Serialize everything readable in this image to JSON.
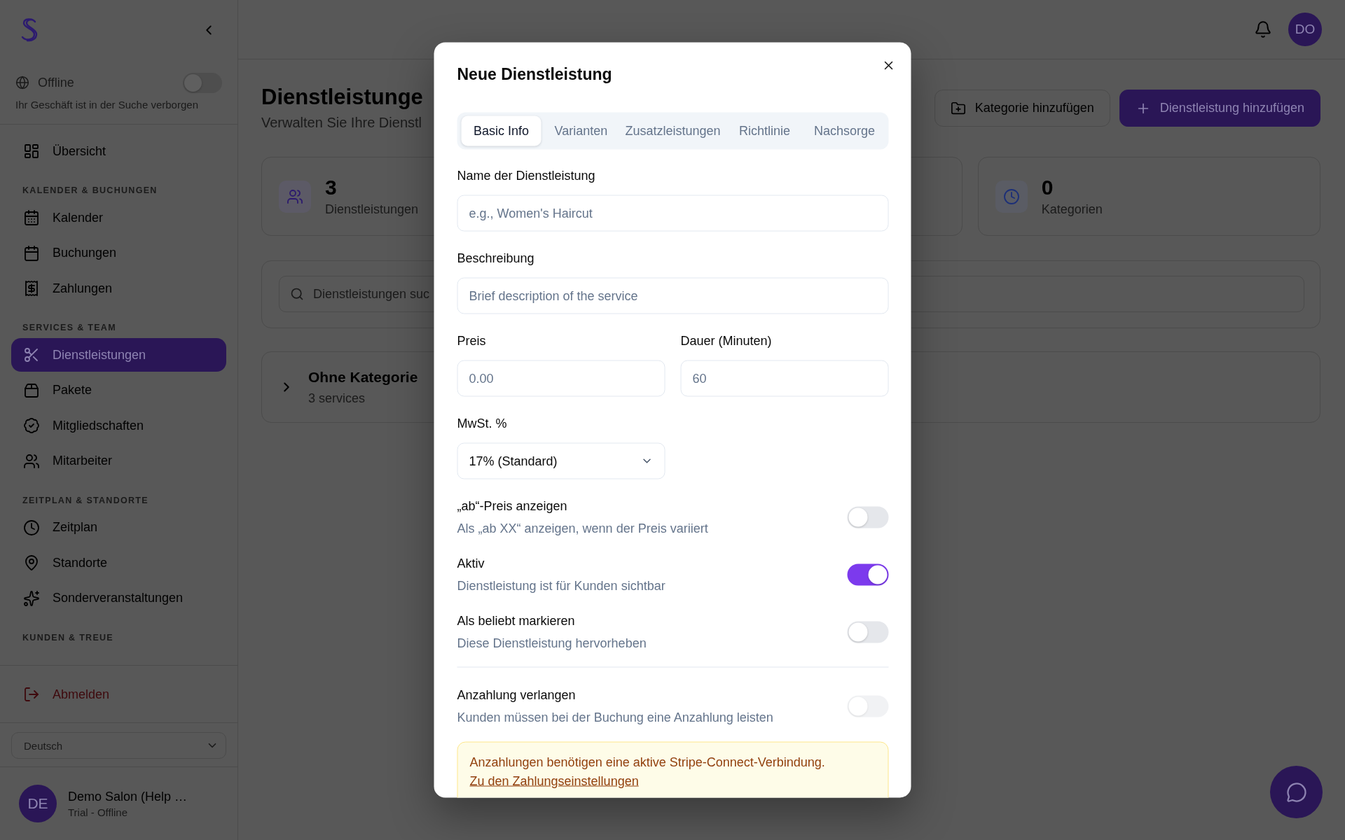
{
  "sidebar": {
    "status": {
      "label": "Offline",
      "description": "Ihr Geschäft ist in der Suche verborgen",
      "on": false
    },
    "nav": [
      {
        "items": [
          {
            "label": "Übersicht",
            "selected": false
          }
        ]
      },
      {
        "heading": "KALENDER & BUCHUNGEN",
        "items": [
          {
            "label": "Kalender",
            "selected": false
          },
          {
            "label": "Buchungen",
            "selected": false
          },
          {
            "label": "Zahlungen",
            "selected": false
          }
        ]
      },
      {
        "heading": "SERVICES & TEAM",
        "items": [
          {
            "label": "Dienstleistungen",
            "selected": true
          },
          {
            "label": "Pakete",
            "selected": false
          },
          {
            "label": "Mitgliedschaften",
            "selected": false
          },
          {
            "label": "Mitarbeiter",
            "selected": false
          }
        ]
      },
      {
        "heading": "ZEITPLAN & STANDORTE",
        "items": [
          {
            "label": "Zeitplan",
            "selected": false
          },
          {
            "label": "Standorte",
            "selected": false
          },
          {
            "label": "Sonderveranstaltungen",
            "selected": false
          }
        ]
      },
      {
        "heading": "KUNDEN & TREUE"
      }
    ],
    "logout": {
      "label": "Abmelden"
    },
    "language": {
      "value": "Deutsch"
    },
    "account": {
      "initials": "DE",
      "name": "Demo Salon (Help …",
      "status": "Trial - Offline"
    }
  },
  "topbar": {
    "avatar": "DO"
  },
  "page": {
    "title": "Dienstleistunge",
    "subtitle": "Verwalten Sie Ihre Dienstl",
    "buttons": [
      {
        "kind": "secondary",
        "label": "Kategorie hinzufügen"
      },
      {
        "kind": "primary",
        "label": "Dienstleistung hinzufügen"
      }
    ],
    "stats": [
      {
        "kind": "stat",
        "value": "3",
        "label": "Dienstleistungen"
      },
      {
        "kind": "covered"
      },
      {
        "kind": "stat",
        "value": "0",
        "label": "Kategorien"
      }
    ],
    "search": {
      "placeholder": "Dienstleistungen suc"
    },
    "categories": [
      {
        "name": "Ohne Kategorie",
        "count": "3 services",
        "expanded": false
      }
    ]
  },
  "dialog": {
    "title": "Neue Dienstleistung",
    "tabs": [
      {
        "label": "Basic Info",
        "selected": true
      },
      {
        "label": "Varianten",
        "selected": false
      },
      {
        "label": "Zusatzleistungen",
        "selected": false
      },
      {
        "label": "Richtlinie",
        "selected": false
      },
      {
        "label": "Nachsorge",
        "selected": false
      }
    ],
    "fields": [
      {
        "label": "Name der Dienstleistung",
        "placeholder": "e.g., Women's Haircut"
      },
      {
        "label": "Beschreibung",
        "placeholder": "Brief description of the service"
      }
    ],
    "pair_fields": [
      {
        "label": "Preis",
        "placeholder": "0.00"
      },
      {
        "label": "Dauer (Minuten)",
        "placeholder": "60"
      }
    ],
    "vat": {
      "label": "MwSt. %",
      "value": "17% (Standard)"
    },
    "toggles": [
      {
        "label": "„ab“-Preis anzeigen",
        "description": "Als „ab XX“ anzeigen, wenn der Preis variiert",
        "on": false,
        "disabled": false
      },
      {
        "label": "Aktiv",
        "description": "Dienstleistung ist für Kunden sichtbar",
        "on": true,
        "disabled": false
      },
      {
        "label": "Als beliebt markieren",
        "description": "Diese Dienstleistung hervorheben",
        "on": false,
        "disabled": false
      }
    ],
    "deposit": {
      "label": "Anzahlung verlangen",
      "description": "Kunden müssen bei der Buchung eine Anzahlung leisten",
      "on": false,
      "disabled": true,
      "alert": {
        "text": "Anzahlungen benötigen eine aktive Stripe-Connect-Verbindung.",
        "link": "Zu den Zahlungseinstellungen"
      }
    }
  }
}
